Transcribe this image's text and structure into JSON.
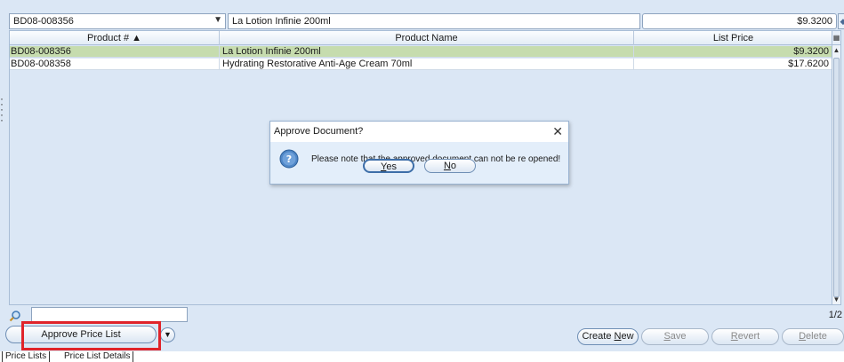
{
  "filter": {
    "product_combo_value": "BD08-008356",
    "product_name_value": "La Lotion Infinie 200ml",
    "list_price_value": "$9.3200"
  },
  "grid": {
    "columns": [
      "Product # ▲",
      "Product Name",
      "List Price"
    ],
    "rows": [
      {
        "product_no": "BD08-008356",
        "product_name": "La Lotion Infinie 200ml",
        "list_price": "$9.3200",
        "selected": true
      },
      {
        "product_no": "BD08-008358",
        "product_name": "Hydrating Restorative Anti-Age Cream 70ml",
        "list_price": "$17.6200",
        "selected": false
      }
    ]
  },
  "footer": {
    "page_count": "1/2",
    "approve_label": "Approve Price List",
    "create_label_pre": "Create ",
    "create_label_key": "N",
    "create_label_post": "ew",
    "save_key": "S",
    "save_rest": "ave",
    "revert_key": "R",
    "revert_rest": "evert",
    "delete_key": "D",
    "delete_rest": "elete"
  },
  "tabs": [
    "Price Lists",
    "Price List Details"
  ],
  "dialog": {
    "title": "Approve Document?",
    "message": "Please note that the approved document can not be re opened!",
    "yes_key": "Y",
    "yes_rest": "es",
    "no_key": "N",
    "no_rest": "o"
  },
  "icons": {
    "dialog_question": "question-icon",
    "search": "search-icon",
    "close": "close-icon",
    "menu": "chevron-down-icon"
  },
  "colors": {
    "selected_row": "#c6dcae",
    "highlight": "#e0242a",
    "background": "#dbe7f5"
  }
}
